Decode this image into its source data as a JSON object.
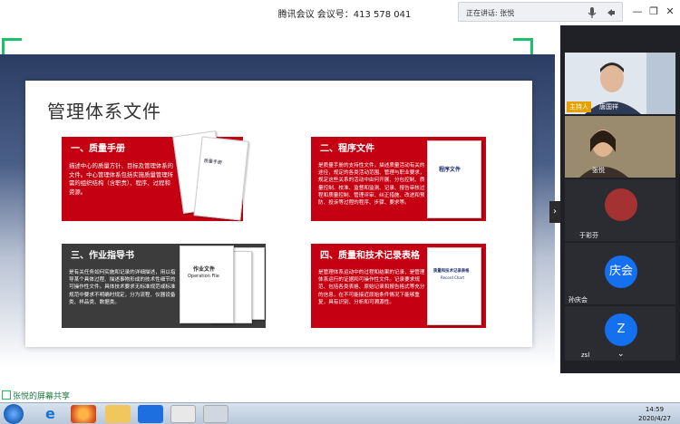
{
  "titlebar": {
    "title": "腾讯会议 会议号：413 578 041",
    "speaking": "正在讲话: 张悦",
    "minimize": "—",
    "maximize": "❐",
    "close": "✕"
  },
  "slide": {
    "heading": "管理体系文件",
    "cards": [
      {
        "title": "一、质量手册",
        "desc": "描述中心的质量方针、目标及管理体系的文件。中心管理体系包括实施质量管理所需的组织结构（含职责）、程序、过程和资源。",
        "doc_label": "质量手册"
      },
      {
        "title": "二、程序文件",
        "desc": "是质量手册的支持性文件，描述质量活动有关的途径，规定的各类活动范围、管理与职业要求，规定这些关系的活动中由何开展、分包控制、质量控制、校准、监督和监测、记录、报告审核过程和质量控制、管理评审、纠正措施、改进和预防、投诉等过程的程序、步骤、要求等。",
        "doc_label": "程序文件"
      },
      {
        "title": "三、作业指导书",
        "desc": "是有关任务如何实施和记录的详细描述，用以指导某个具体过程、描述事物形成的技术性细节的可操作性文件。具体技术要求无标准规范或标准规范中要求不明确时规定，分为流程、仪器设备类、样品类、数据类。",
        "doc_label": "作业文件",
        "doc_sub": "Operation File"
      },
      {
        "title": "四、质量和技术记录表格",
        "desc": "是管理体系运动中的过程和结果的记录，是管理体系运行的证据和可操作性文件。记录要求规范、包括各类表格、原始记录和报告格式等充分的信息，在不可能接近原始条件情况下能够重复，具有识别、分析和可溯源性。",
        "doc_label": "质量和技术记录表格",
        "doc_sub": "Record Chart"
      }
    ]
  },
  "share_footer": "张悦的屏幕共享",
  "participants": [
    {
      "name": "唐国祥",
      "tag": "主持人"
    },
    {
      "name": "张悦"
    },
    {
      "name": "于彩芬"
    },
    {
      "name": "孙庆会",
      "avatar_text": "庆会"
    },
    {
      "name": "zsl",
      "avatar_text": "Z"
    }
  ],
  "clock": {
    "time": "14:59",
    "date": "2020/4/27"
  },
  "colors": {
    "red": "#c40012",
    "dark": "#3c3c3c",
    "accent": "#1fbf6a",
    "blue": "#1570ef"
  }
}
